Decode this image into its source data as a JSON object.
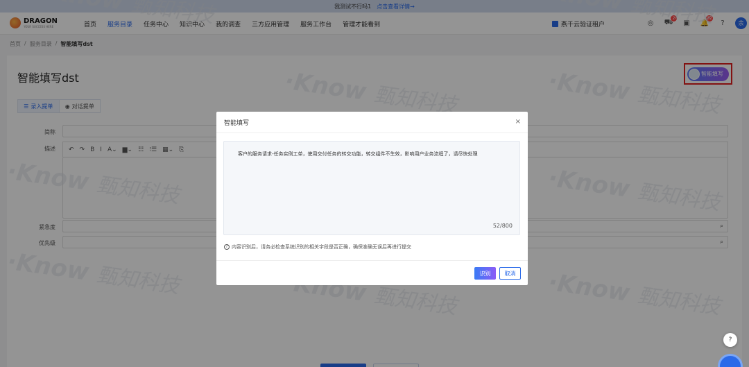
{
  "banner": {
    "text": "我测试不行吗1",
    "link": "点击查看详情→"
  },
  "header": {
    "logo": {
      "name": "DRAGON",
      "tagline": "YOUR SUCCESS HERE"
    },
    "nav": [
      {
        "label": "首页",
        "active": false
      },
      {
        "label": "服务目录",
        "active": true
      },
      {
        "label": "任务中心",
        "active": false
      },
      {
        "label": "知识中心",
        "active": false
      },
      {
        "label": "我的调查",
        "active": false
      },
      {
        "label": "三方应用管理",
        "active": false
      },
      {
        "label": "服务工作台",
        "active": false
      },
      {
        "label": "管理才能看到",
        "active": false
      }
    ],
    "tenant": "燕千云验证租户",
    "icons": [
      {
        "name": "user-circle-icon",
        "glyph": "◎",
        "badge": ""
      },
      {
        "name": "cart-icon",
        "glyph": "⛟",
        "badge": "2"
      },
      {
        "name": "calendar-icon",
        "glyph": "▣",
        "badge": ""
      },
      {
        "name": "bell-icon",
        "glyph": "🔔",
        "badge": "32"
      },
      {
        "name": "help-icon",
        "glyph": "?",
        "badge": ""
      }
    ],
    "avatar": "余"
  },
  "breadcrumb": {
    "home": "首页",
    "sep": "/",
    "catalog": "服务目录",
    "current": "智能填写dst"
  },
  "page": {
    "title": "智能填写dst",
    "smart_button": "智能填写",
    "tabs": [
      {
        "label": "录入提单",
        "icon": "☰"
      },
      {
        "label": "对话提单",
        "icon": "◉"
      }
    ],
    "fields": {
      "name": "简称",
      "desc": "描述",
      "urgency": "紧急度",
      "priority": "优先级"
    },
    "editor_tools": [
      "↶",
      "↷",
      "B",
      "I",
      "A⌄",
      "▆⌄",
      "☷",
      "⁝☰",
      "▦⌄",
      "⎘"
    ]
  },
  "watermark": {
    "latin": "·Know",
    "cn": "甄知科技"
  },
  "modal": {
    "title": "智能填写",
    "close": "×",
    "textarea_value": "客户的服务请求-任务实例工单，使用交付任务的转交功能，转交组件不生效，影响用户业务流程了，请尽快处理",
    "counter": "52/800",
    "hint": "内容识别后，请务必检查系统识别的相关字段是否正确，确保准确无误后再进行提交",
    "recognize": "识别",
    "cancel": "取消"
  },
  "floating": {
    "help": "?"
  },
  "colors": {
    "primary": "#2a6ae9",
    "highlight_box": "#e02020"
  }
}
